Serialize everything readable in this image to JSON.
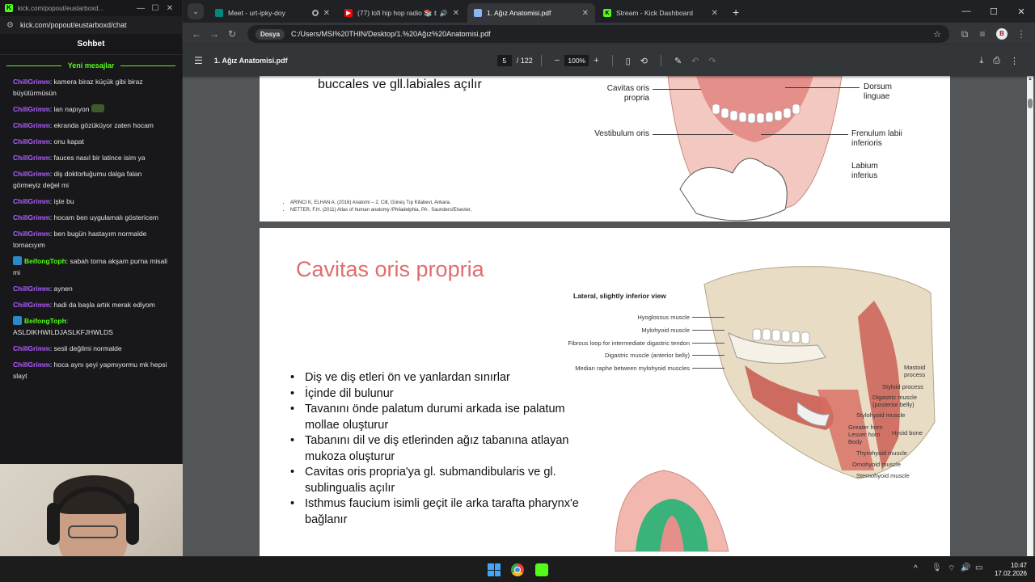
{
  "kick": {
    "window_title": "kick.com/popout/eustarboxd...",
    "url": "kick.com/popout/eustarboxd/chat",
    "header": "Sohbet",
    "new_messages_label": "Yeni mesajlar",
    "messages": [
      {
        "user": "ChillGrimm",
        "text": "kamera biraz küçük gibi biraz büyütürmüsün",
        "color": "#b05cff",
        "badge": false,
        "emote": false
      },
      {
        "user": "ChillGrimm",
        "text": "lan napıyon",
        "color": "#b05cff",
        "badge": false,
        "emote": true
      },
      {
        "user": "ChillGrimm",
        "text": "ekranda gözüküyor zaten hocam",
        "color": "#b05cff",
        "badge": false,
        "emote": false
      },
      {
        "user": "ChillGrimm",
        "text": "onu kapat",
        "color": "#b05cff",
        "badge": false,
        "emote": false
      },
      {
        "user": "ChillGrimm",
        "text": "fauces nasıl bir latince isim ya",
        "color": "#b05cff",
        "badge": false,
        "emote": false
      },
      {
        "user": "ChillGrimm",
        "text": "diş doktorluğumu dalga falan görmeyiz değel mi",
        "color": "#b05cff",
        "badge": false,
        "emote": false
      },
      {
        "user": "ChillGrimm",
        "text": "işte bu",
        "color": "#b05cff",
        "badge": false,
        "emote": false
      },
      {
        "user": "ChillGrimm",
        "text": "hocam ben uygulamalı göstericem",
        "color": "#b05cff",
        "badge": false,
        "emote": false
      },
      {
        "user": "ChillGrimm",
        "text": "ben bugün hastayım normalde tornacıyım",
        "color": "#b05cff",
        "badge": false,
        "emote": false
      },
      {
        "user": "BeifongToph",
        "text": "sabah torna akşam purna misali mi",
        "color": "#53fc18",
        "badge": true,
        "emote": false
      },
      {
        "user": "ChillGrimm",
        "text": "aynen",
        "color": "#b05cff",
        "badge": false,
        "emote": false
      },
      {
        "user": "ChillGrimm",
        "text": "hadi da başla artık merak ediyom",
        "color": "#b05cff",
        "badge": false,
        "emote": false
      },
      {
        "user": "BeifongToph",
        "text": "ASLDIKHWILDJASLKFJHWLDS",
        "color": "#53fc18",
        "badge": true,
        "emote": false
      },
      {
        "user": "ChillGrimm",
        "text": "sesli değilmi normalde",
        "color": "#b05cff",
        "badge": false,
        "emote": false
      },
      {
        "user": "ChillGrimm",
        "text": "hoca aynı şeyi yapmıyormu mk hepsi slayt",
        "color": "#b05cff",
        "badge": false,
        "emote": false
      }
    ]
  },
  "browser": {
    "tabs": [
      {
        "label": "Meet - urt-ipky-doy",
        "active": false,
        "favicon": "meet-icon",
        "fav_color": "#00897b",
        "fav_text": ""
      },
      {
        "label": "(77) lofi hip hop radio 📚 b",
        "active": false,
        "favicon": "youtube-icon",
        "fav_color": "#ff0000",
        "fav_text": "▶"
      },
      {
        "label": "1. Ağız Anatomisi.pdf",
        "active": true,
        "favicon": "globe-icon",
        "fav_color": "#8ab4f8",
        "fav_text": ""
      },
      {
        "label": "Stream - Kick Dashboard",
        "active": false,
        "favicon": "kick-icon",
        "fav_color": "#53fc18",
        "fav_text": "K"
      }
    ],
    "address_chip": "Dosya",
    "address": "C:/Users/MSI%20THIN/Desktop/1.%20Ağız%20Anatomisi.pdf",
    "profile_letter": "B"
  },
  "pdf": {
    "filename": "1. Ağız Anatomisi.pdf",
    "page_current": "5",
    "page_total": "/ 122",
    "zoom": "100%",
    "top_page": {
      "text": "buccales ve gll.labiales açılır",
      "labels_left": [
        "Cavitas oris propria",
        "Vestibulum oris"
      ],
      "labels_right": [
        "Dorsum linguae",
        "Frenulum labii inferioris",
        "Labium inferius"
      ],
      "references": [
        "ARINCI K, ELHAN A. (2016) Anatomi – 2. Cilt, Güneş Tıp Kitabevi, Ankara.",
        "NETTER, F.H. (2011) Atlas of human anatomy /Philadelphia, PA : Saunders/Elsevier,"
      ]
    },
    "main_page": {
      "title": "Cavitas oris propria",
      "bullets": [
        "Diş ve diş etleri ön ve yanlardan sınırlar",
        "İçinde dil bulunur",
        "Tavanını önde palatum durumi arkada ise palatum mollae oluşturur",
        "Tabanını dil ve diş etlerinden ağız tabanına atlayan mukoza oluşturur",
        "Cavitas oris propria'ya gl. submandibularis ve gl. sublingualis açılır",
        "Isthmus faucium isimli geçit ile arka tarafta pharynx'e bağlanır"
      ],
      "figure_title": "Lateral, slightly inferior view",
      "figure_labels_left": [
        "Hyoglossus muscle",
        "Mylohyoid muscle",
        "Fibrous loop for intermediate digastric tendon",
        "Digastric muscle (anterior belly)",
        "Median raphe between mylohyoid muscles"
      ],
      "figure_labels_right": [
        "Mastoid process",
        "Styloid process",
        "Digastric muscle (posterior belly)",
        "Stylohyoid muscle",
        "Greater horn",
        "Lesser horn",
        "Body",
        "Hyoid bone",
        "Thyrohyoid muscle",
        "Omohyoid muscle",
        "Sternohyoid muscle"
      ]
    }
  },
  "taskbar": {
    "time": "10:47",
    "date": "17.02.2026"
  }
}
